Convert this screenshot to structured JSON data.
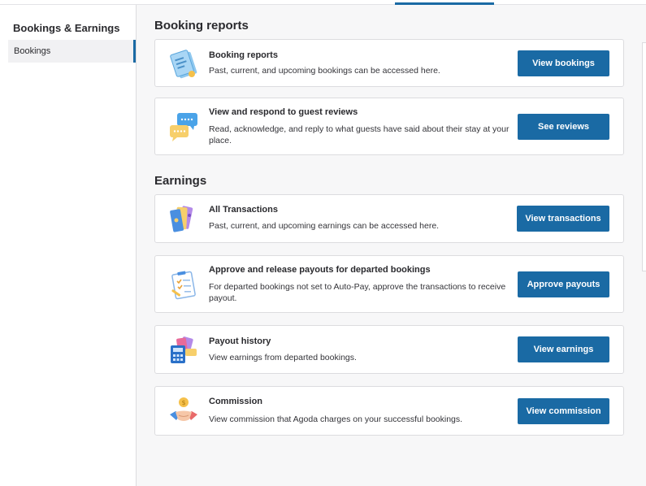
{
  "sidebar": {
    "title": "Bookings & Earnings",
    "items": [
      {
        "label": "Bookings",
        "active": true
      }
    ]
  },
  "sections": {
    "booking_reports": {
      "title": "Booking reports"
    },
    "earnings": {
      "title": "Earnings"
    }
  },
  "cards": [
    {
      "title": "Booking reports",
      "description": "Past, current, and upcoming bookings can be accessed here.",
      "button": "View bookings",
      "icon": "document-report-icon"
    },
    {
      "title": "View and respond to guest reviews",
      "description": "Read, acknowledge, and reply to what guests have said about their stay at your place.",
      "button": "See reviews",
      "icon": "chat-bubbles-icon"
    },
    {
      "title": "All Transactions",
      "description": "Past, current, and upcoming earnings can be accessed here.",
      "button": "View transactions",
      "icon": "tickets-icon"
    },
    {
      "title": "Approve and release payouts for departed bookings",
      "description": "For departed bookings not set to Auto-Pay, approve the transactions to receive payout.",
      "button": "Approve payouts",
      "icon": "clipboard-checklist-icon"
    },
    {
      "title": "Payout history",
      "description": "View earnings from departed bookings.",
      "button": "View earnings",
      "icon": "calculator-cards-icon"
    },
    {
      "title": "Commission",
      "description": "View commission that Agoda charges on your successful bookings.",
      "button": "View commission",
      "icon": "handshake-coin-icon"
    }
  ],
  "colors": {
    "accent": "#1a6aa4",
    "background": "#f7f7f8",
    "card_border": "#dcdcdf"
  }
}
